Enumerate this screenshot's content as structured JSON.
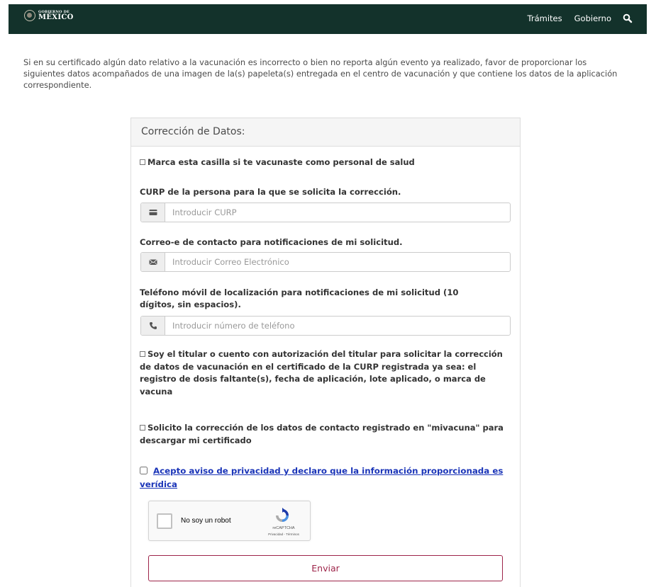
{
  "header": {
    "logo_small": "GOBIERNO DE",
    "logo_big": "MÉXICO",
    "nav": [
      "Trámites",
      "Gobierno"
    ],
    "search_icon": "search-icon",
    "bg_color": "#13322b"
  },
  "intro": "Si en su certificado algún dato relativo a la vacunación es incorrecto o bien no reporta algún evento ya realizado, favor de proporcionar los siguientes datos acompañados de una imagen de la(s) papeleta(s) entregada en el centro de vacunación y que contiene los datos de la aplicación correspondiente.",
  "form": {
    "title": "Corrección de Datos:",
    "health_staff_checkbox": "Marca esta casilla si te vacunaste como personal de salud",
    "curp_label": "CURP de la persona para la que se solicita la corrección.",
    "curp_placeholder": "Introducir CURP",
    "curp_icon": "id-card-icon",
    "email_label": "Correo-e de contacto para notificaciones de mi solicitud.",
    "email_placeholder": "Introducir Correo Electrónico",
    "email_icon": "envelope-icon",
    "phone_label": "Teléfono móvil de localización para notificaciones de mi solicitud (10 dígitos, sin espacios).",
    "phone_placeholder": "Introducir número de teléfono",
    "phone_icon": "phone-icon",
    "owner_checkbox": "Soy el titular o cuento con autorización del titular para solicitar la corrección de datos de vacunación en el certificado de la CURP registrada ya sea: el registro de dosis faltante(s), fecha de aplicación, lote aplicado, o marca de vacuna",
    "contact_checkbox": "Solicito la corrección de los datos de contacto registrado en \"mivacuna\" para descargar mi certificado",
    "privacy_link": "Acepto aviso de privacidad y declaro que la información proporcionada es verídica",
    "captcha": {
      "label": "No soy un robot",
      "brand": "reCAPTCHA",
      "terms": "Privacidad - Términos"
    },
    "submit_label": "Enviar",
    "accent_color": "#9d2449",
    "link_color": "#1b35b8"
  }
}
